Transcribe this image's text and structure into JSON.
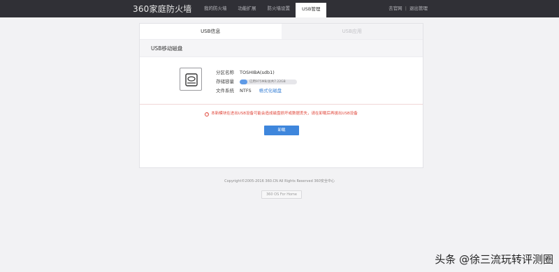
{
  "header": {
    "logo": "360家庭防火墙",
    "nav": [
      "我的防火墙",
      "功能扩展",
      "防火墙设置",
      "USB管理"
    ],
    "active_nav": "USB管理",
    "links": {
      "feedback": "去官网",
      "separator": "|",
      "logout": "退出管理"
    }
  },
  "card": {
    "tabs": {
      "info": "USB信息",
      "apps": "USB应用"
    },
    "section_title": "USB移动磁盘",
    "disk": {
      "partition_label": "分区名称",
      "partition_value": "TOSHIBA(sdb1)",
      "capacity_label": "存储容量",
      "capacity_text": "已用975MB/总共7.22GB",
      "used_fraction": 0.13,
      "fs_label": "文件系统",
      "fs_value": "NTFS",
      "format_link": "格式化磁盘"
    },
    "warning": "本新模块在进出USB设备可能会造成磁盘损坏或数据丢失，请在卸载后再拔出USB设备",
    "unmount_button": "卸载"
  },
  "footer": {
    "copyright": "Copyright©2005-2016 360.CN All Rights Reserved 360安全中心",
    "home_button": "360 OS For Home"
  },
  "watermark": "头条 @徐三流玩转评测圈",
  "colors": {
    "topbar": "#303036",
    "accent": "#3e86dc",
    "warning": "#e0483c"
  }
}
